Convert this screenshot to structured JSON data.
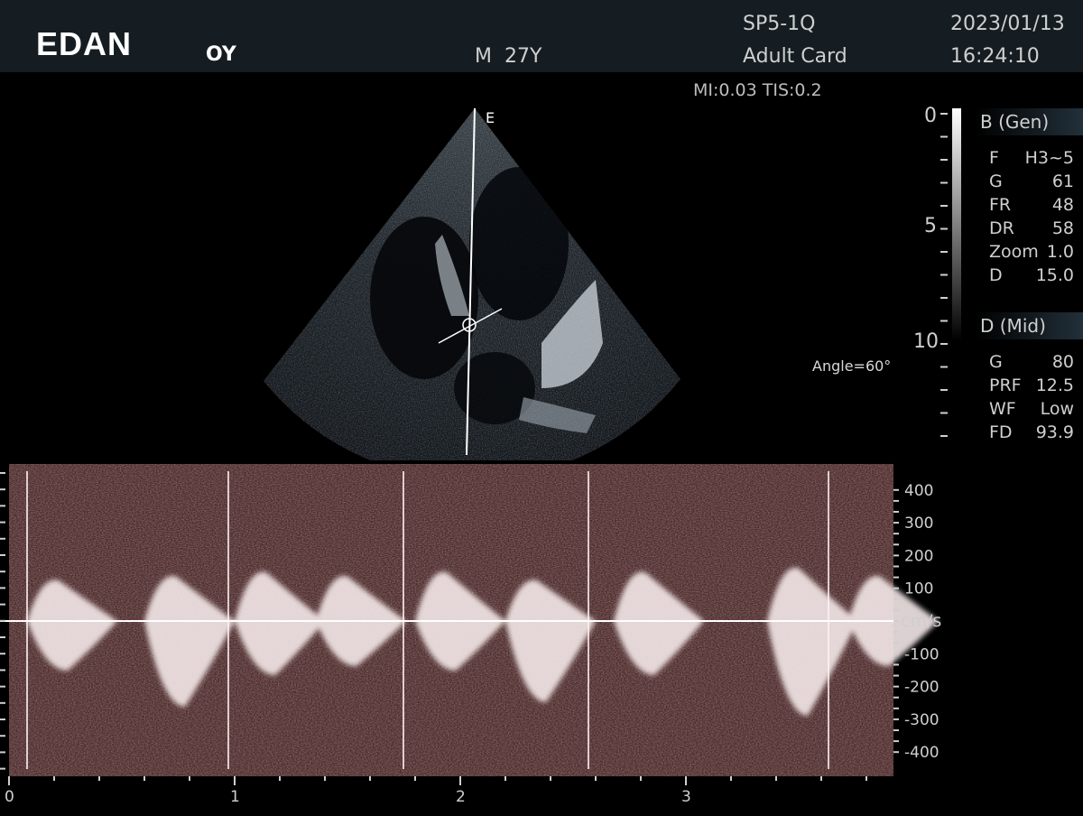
{
  "header": {
    "logo": "EDAN",
    "patient_id": "OY",
    "patient_sex_age": "M  27Y",
    "probe": "SP5-1Q",
    "preset": "Adult Card",
    "date": "2023/01/13",
    "time": "16:24:10"
  },
  "safety": {
    "mi_tis": "MI:0.03 TIS:0.2"
  },
  "image": {
    "sector_marker": "E",
    "angle_label": "Angle=60°"
  },
  "depth_scale": {
    "labels": [
      "0",
      "5",
      "10"
    ]
  },
  "b_mode": {
    "title": "B (Gen)",
    "params": [
      {
        "key": "F",
        "value": "H3~5"
      },
      {
        "key": "G",
        "value": "61"
      },
      {
        "key": "FR",
        "value": "48"
      },
      {
        "key": "DR",
        "value": "58"
      },
      {
        "key": "Zoom",
        "value": "1.0"
      },
      {
        "key": "D",
        "value": "15.0"
      }
    ]
  },
  "d_mode": {
    "title": "D (Mid)",
    "params": [
      {
        "key": "G",
        "value": "80"
      },
      {
        "key": "PRF",
        "value": "12.5"
      },
      {
        "key": "WF",
        "value": "Low"
      },
      {
        "key": "FD",
        "value": "93.9"
      }
    ]
  },
  "velocity_scale": {
    "unit": "cm/s",
    "labels": [
      "400",
      "300",
      "200",
      "100",
      "-100",
      "-200",
      "-300",
      "-400"
    ]
  },
  "time_axis": {
    "labels": [
      "0",
      "1",
      "2",
      "3"
    ]
  },
  "colors": {
    "header_bg": "#151d22",
    "spectral_bg": "#4a2a2a",
    "spectral_bright": "#f4e8e8"
  }
}
